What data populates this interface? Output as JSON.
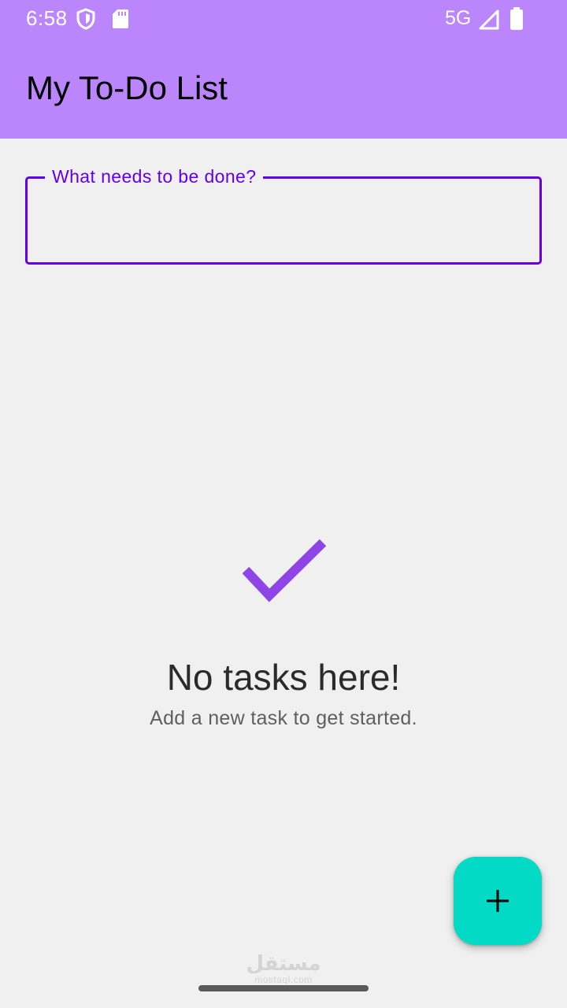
{
  "status_bar": {
    "time": "6:58",
    "network": "5G",
    "icons": [
      "shield-icon",
      "sd-card-icon",
      "signal-icon",
      "battery-icon"
    ]
  },
  "app_bar": {
    "title": "My To-Do List",
    "color": "#bb86fc"
  },
  "task_input": {
    "label": "What needs to be done?",
    "value": "",
    "accent_color": "#6200ee"
  },
  "empty_state": {
    "icon": "checkmark-icon",
    "icon_color": "#8e44e6",
    "title": "No tasks here!",
    "subtitle": "Add a new task to get started."
  },
  "fab": {
    "icon": "plus-icon",
    "color": "#03dac5"
  },
  "watermark": {
    "arabic": "مستقل",
    "latin": "mostaql.com"
  }
}
